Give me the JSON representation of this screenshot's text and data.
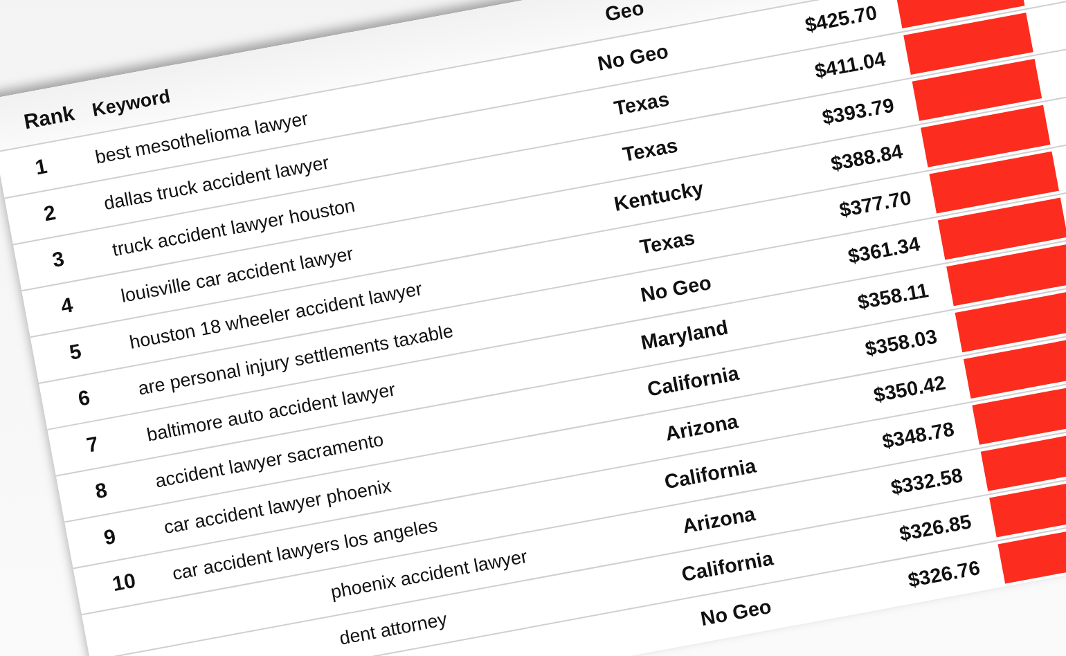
{
  "table": {
    "columns": [
      "Rank",
      "Keyword",
      "Geo"
    ],
    "rows": [
      {
        "rank": "1",
        "keyword": "best mesothelioma lawyer",
        "geo": "No Geo",
        "price": "$425.70"
      },
      {
        "rank": "2",
        "keyword": "dallas truck accident lawyer",
        "geo": "Texas",
        "price": "$411.04"
      },
      {
        "rank": "3",
        "keyword": "truck accident lawyer houston",
        "geo": "Texas",
        "price": "$393.79"
      },
      {
        "rank": "4",
        "keyword": "louisville car accident lawyer",
        "geo": "Kentucky",
        "price": "$388.84"
      },
      {
        "rank": "5",
        "keyword": "houston 18 wheeler accident lawyer",
        "geo": "Texas",
        "price": "$377.70"
      },
      {
        "rank": "6",
        "keyword": "are personal injury settlements taxable",
        "geo": "No Geo",
        "price": "$361.34"
      },
      {
        "rank": "7",
        "keyword": "baltimore auto accident lawyer",
        "geo": "Maryland",
        "price": "$358.11"
      },
      {
        "rank": "8",
        "keyword": "accident lawyer sacramento",
        "geo": "California",
        "price": "$358.03"
      },
      {
        "rank": "9",
        "keyword": "car accident lawyer phoenix",
        "geo": "Arizona",
        "price": "$350.42"
      },
      {
        "rank": "10",
        "keyword": "car accident lawyers los angeles",
        "geo": "California",
        "price": "$348.78"
      },
      {
        "keyword": "phoenix accident lawyer",
        "geo": "Arizona",
        "price": "$332.58"
      },
      {
        "keyword": "dent attorney",
        "geo": "California",
        "price": "$326.85"
      },
      {
        "geo": "No Geo",
        "price": "$326.76"
      }
    ]
  }
}
